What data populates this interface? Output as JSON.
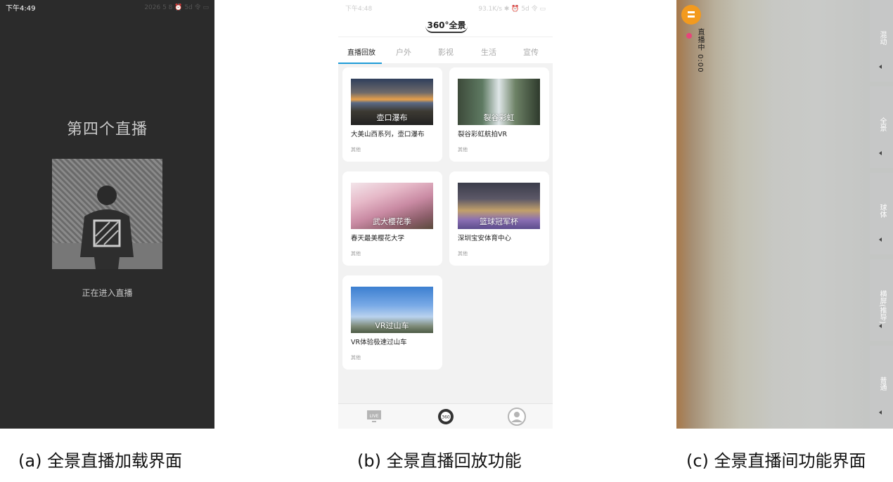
{
  "panel_a": {
    "status_time": "下午4:49",
    "status_right": "2026 5 8 ⏰ 5d 令 ▭",
    "live_title": "第四个直播",
    "loading_text": "正在进入直播",
    "icons": [
      "person-silhouette-icon"
    ]
  },
  "panel_b": {
    "status_time": "下午4:48",
    "status_right": "93.1K/s ✱ ⏰ 5d 令 ▭",
    "logo": "360°全景",
    "tabs": [
      "直播回放",
      "户外",
      "影视",
      "生活",
      "宣传"
    ],
    "active_tab": "直播回放",
    "accent_color": "#1e9bd7",
    "videos": [
      {
        "thumb_label": "壶口瀑布",
        "title": "大美山西系列，壶口瀑布",
        "tag": "其他"
      },
      {
        "thumb_label": "裂谷彩虹",
        "title": "裂谷彩虹航拍VR",
        "tag": "其他"
      },
      {
        "thumb_label": "武大樱花季",
        "title": "春天最美樱花大学",
        "tag": "其他"
      },
      {
        "thumb_label": "篮球冠军杯",
        "title": "深圳宝安体育中心",
        "tag": "其他"
      },
      {
        "thumb_label": "VR过山车",
        "title": "VR体验极速过山车",
        "tag": "其他"
      }
    ],
    "bottom_nav": {
      "live": "LIVE",
      "center": "360"
    },
    "icons": [
      "live-tv-icon",
      "360-camera-icon",
      "user-avatar-icon"
    ]
  },
  "panel_c": {
    "live_status": "直播中 0:00",
    "side_menu": [
      "混动",
      "全景",
      "球体",
      "横屏(推导)",
      "普通"
    ],
    "accent_color": "#f39a1e",
    "live_dot_color": "#e8457a",
    "icons": [
      "menu-icon",
      "live-dot-icon",
      "chevron-left-icon"
    ]
  },
  "captions": {
    "a": "(a) 全景直播加载界面",
    "b": "(b) 全景直播回放功能",
    "c": "(c) 全景直播间功能界面"
  }
}
